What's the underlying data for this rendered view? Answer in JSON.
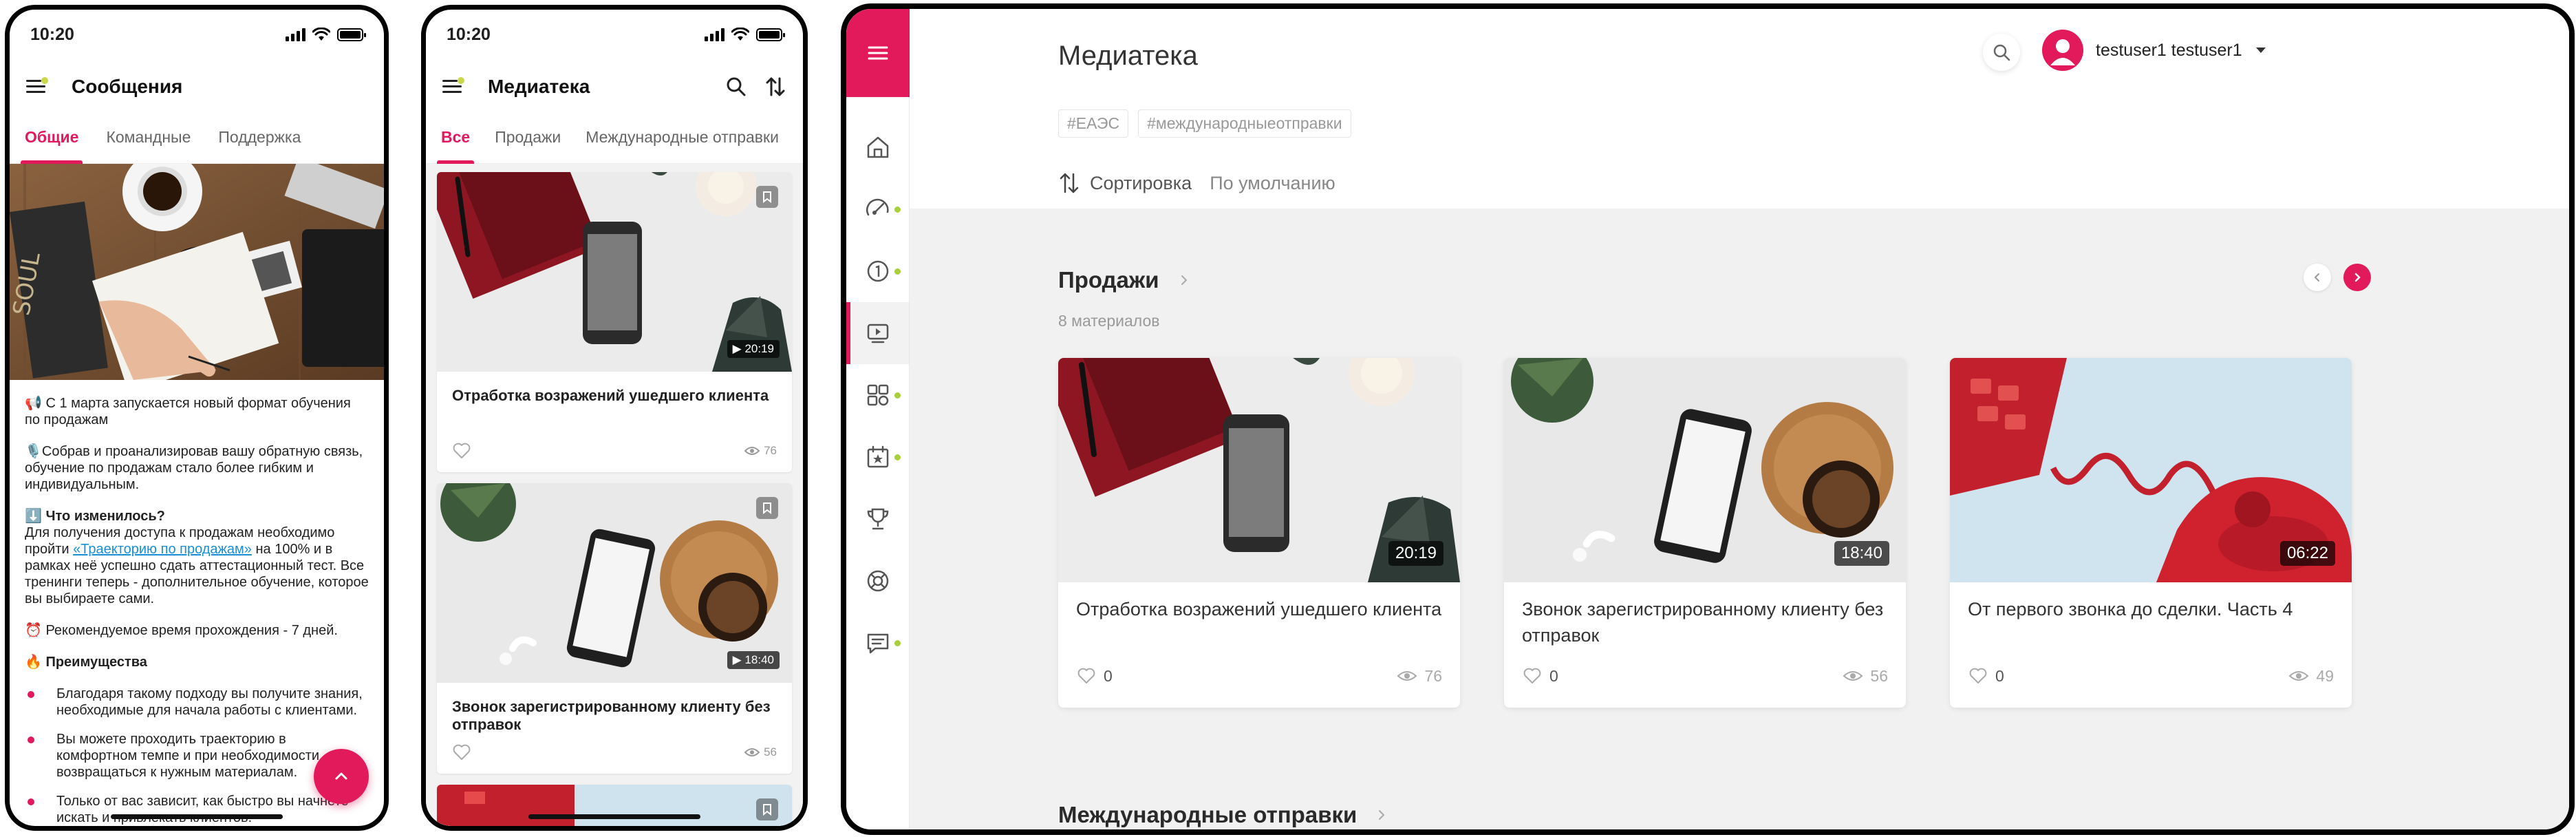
{
  "phone1": {
    "time": "10:20",
    "title": "Сообщения",
    "tabs": [
      "Общие",
      "Командные",
      "Поддержка"
    ],
    "message": {
      "headline": "📢 С 1 марта запускается новый формат обучения по продажам",
      "p1": "🎙️Собрав и проанализировав вашу обратную связь, обучение по продажам стало более гибким и индивидуальным.",
      "what_changed": "⬇️ Что изменилось?",
      "p2_start": "Для получения доступа к продажам необходимо пройти ",
      "p2_link": "«Траекторию по продажам»",
      "p2_end": " на 100% и в рамках неё успешно сдать аттестационный тест. Все тренинги теперь - дополнительное обучение, которое вы выбираете сами.",
      "recommended": "⏰ Рекомендуемое время прохождения - 7 дней.",
      "advantages": "🔥 Преимущества",
      "bullets": [
        "Благодаря такому подходу вы получите знания, необходимые для начала работы с клиентами.",
        "Вы можете проходить траекторию в комфортном темпе и при необходимости возвращаться к нужным материалам.",
        "Только от вас зависит, как быстро вы начнете искать и привлекать клиентов."
      ]
    }
  },
  "phone2": {
    "time": "10:20",
    "title": "Медиатека",
    "tabs": [
      "Все",
      "Продажи",
      "Международные отправки"
    ],
    "cards": [
      {
        "title": "Отработка возражений ушедшего клиента",
        "duration": "▶ 20:19",
        "views": "76"
      },
      {
        "title": "Звонок зарегистрированному клиенту без отправок",
        "duration": "▶ 18:40",
        "views": "56"
      }
    ]
  },
  "tablet": {
    "title": "Медиатека",
    "user": "testuser1 testuser1",
    "tags": [
      "#ЕАЭС",
      "#международныеотправки"
    ],
    "sort_label": "Сортировка",
    "sort_value": "По умолчанию",
    "section1": {
      "title": "Продажи",
      "count": "8 материалов"
    },
    "section2": {
      "title": "Международные отправки"
    },
    "cards": [
      {
        "title": "Отработка возражений ушедшего клиента",
        "duration": "20:19",
        "likes": "0",
        "views": "76"
      },
      {
        "title": "Звонок зарегистрированному клиенту без отправок",
        "duration": "18:40",
        "likes": "0",
        "views": "56"
      },
      {
        "title": "От первого звонка до сделки. Часть 4",
        "duration": "06:22",
        "likes": "0",
        "views": "49"
      }
    ]
  },
  "colors": {
    "accent": "#e2195b",
    "notify_dot": "#a9cf3b"
  },
  "icons": [
    "menu-icon",
    "home-icon",
    "speedometer-icon",
    "info-icon",
    "video-icon",
    "apps-icon",
    "calendar-star-icon",
    "trophy-icon",
    "support-icon",
    "chat-icon",
    "search-icon",
    "sort-icon",
    "bookmark-icon",
    "heart-icon",
    "eye-icon",
    "chevron-up-icon"
  ]
}
